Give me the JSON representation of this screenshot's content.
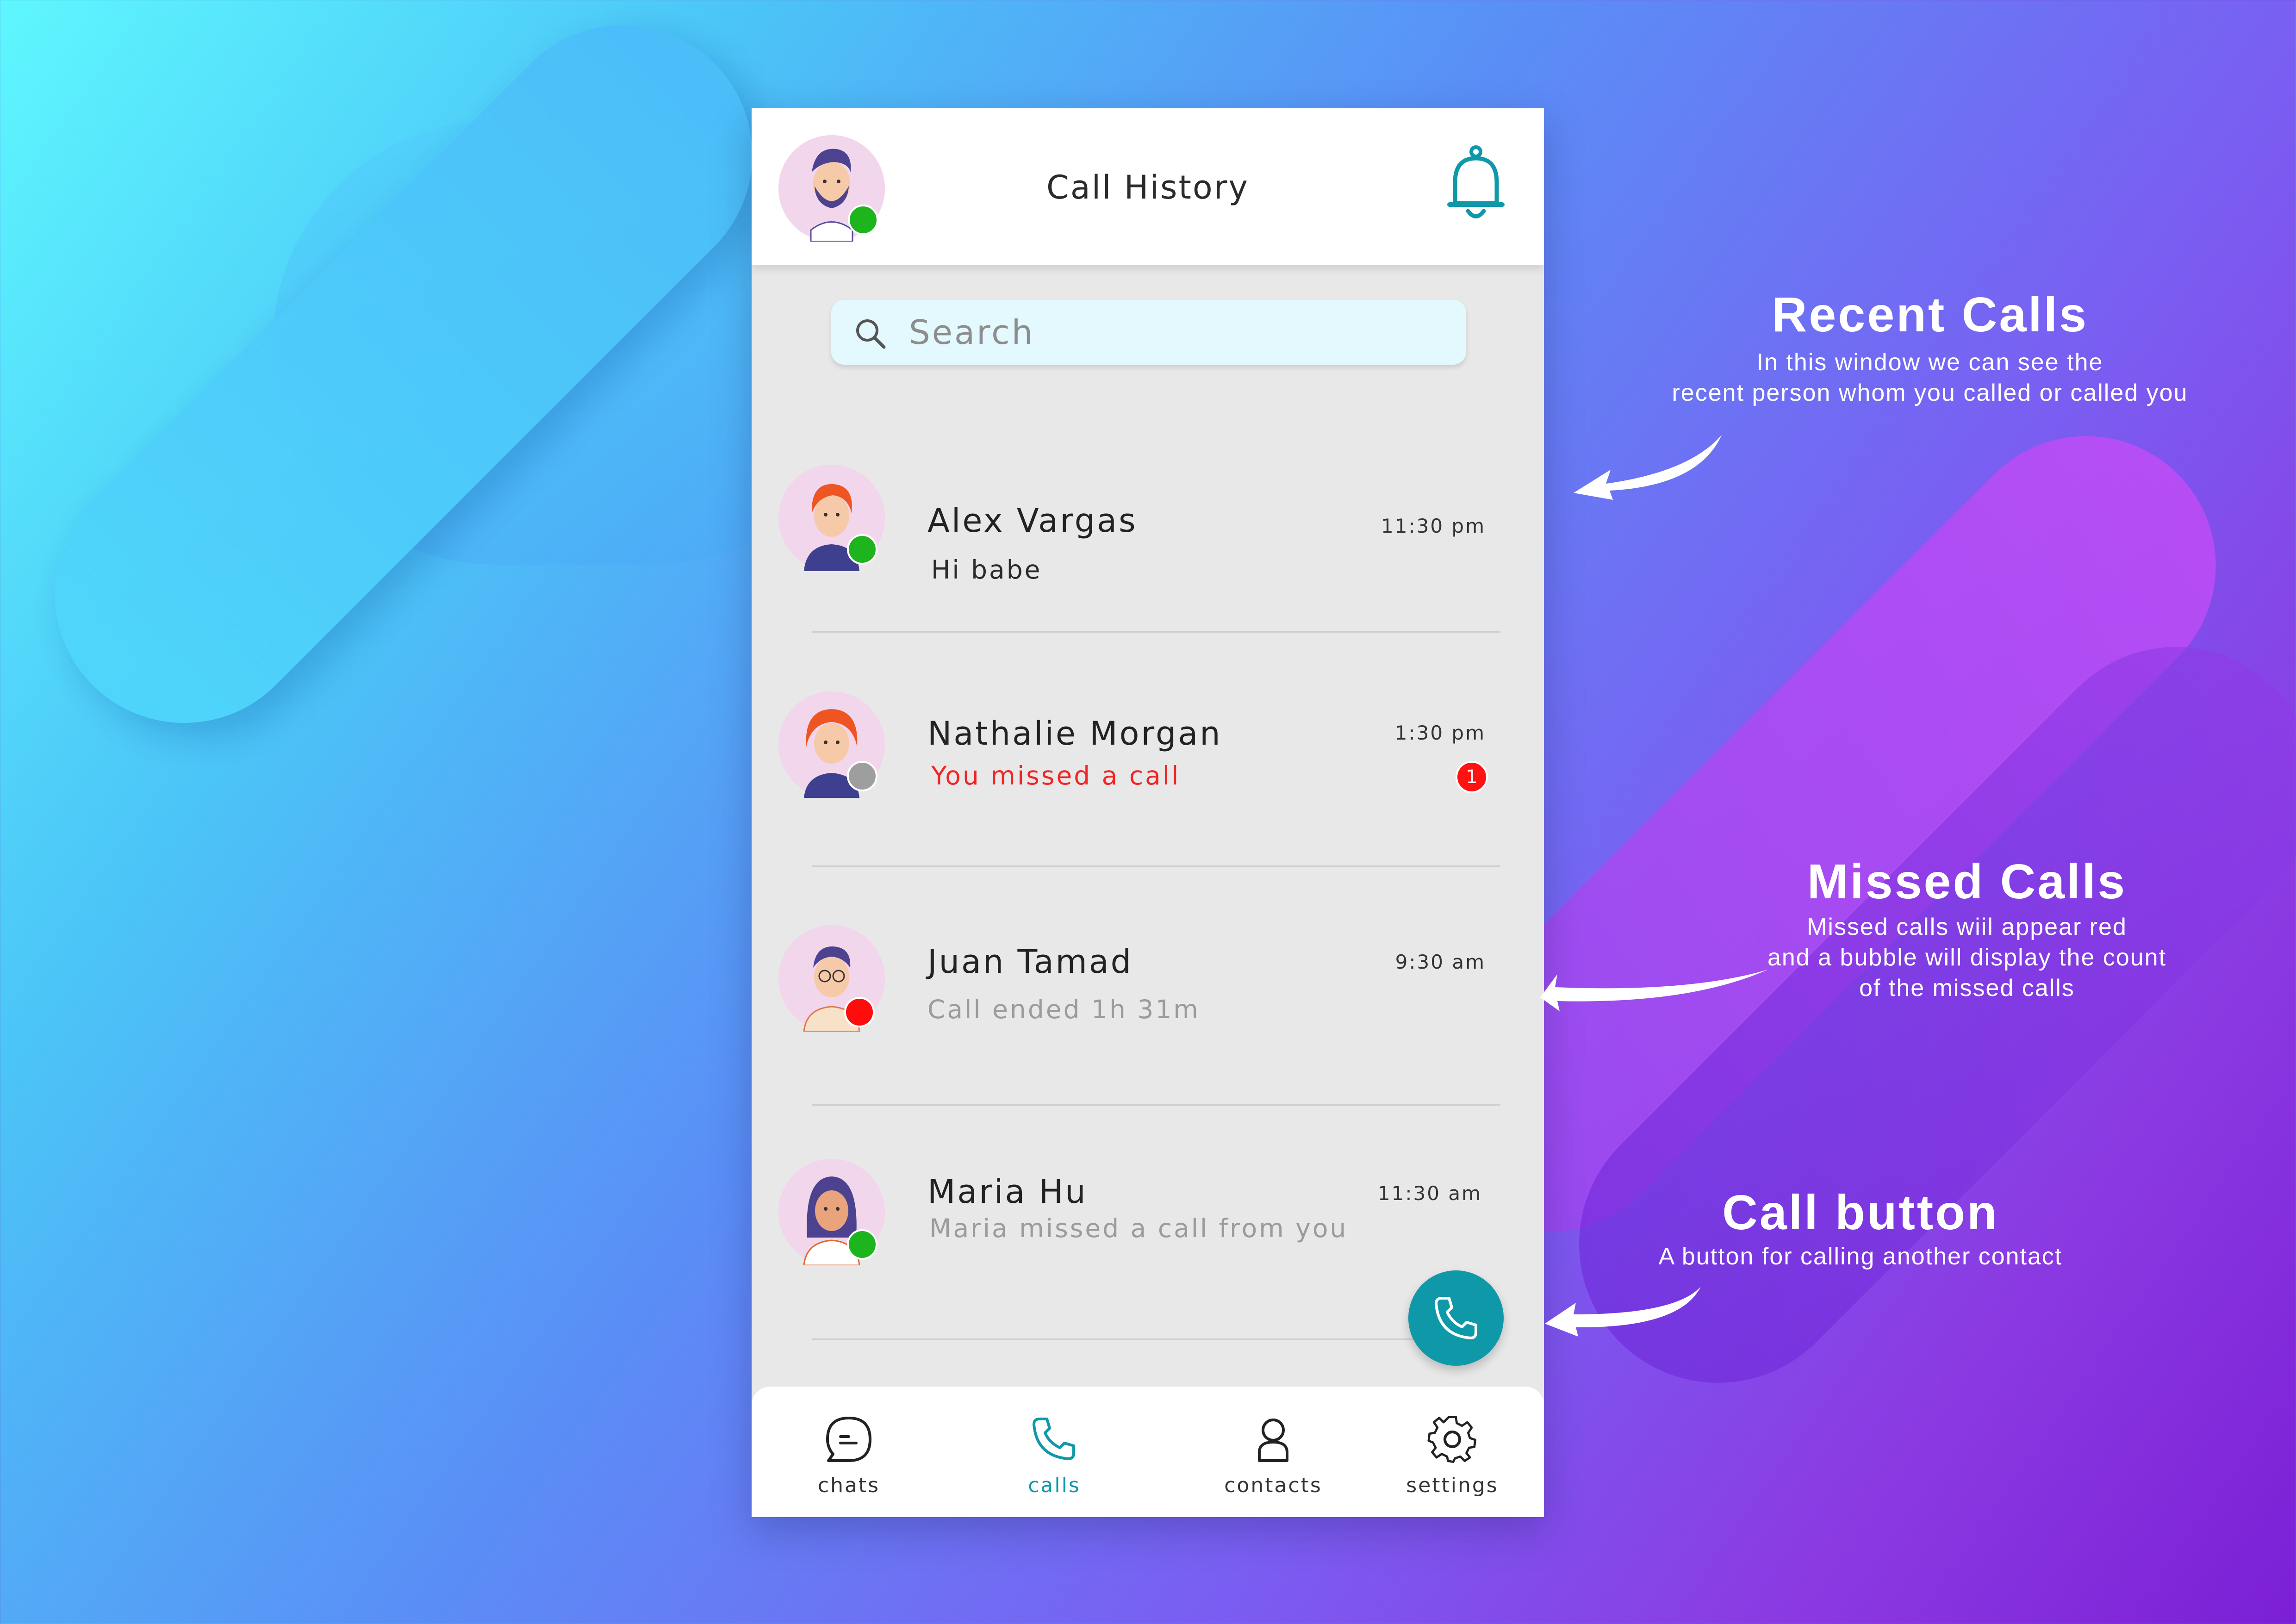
{
  "header": {
    "title": "Call History"
  },
  "search": {
    "placeholder": "Search"
  },
  "calls": [
    {
      "name": "Alex Vargas",
      "subtitle": "Hi babe",
      "time": "11:30 pm",
      "status": "online",
      "status_color": "#1db41d",
      "subtitle_style": "normal"
    },
    {
      "name": "Nathalie Morgan",
      "subtitle": "You missed a call",
      "time": "1:30 pm",
      "status": "offline",
      "status_color": "#9e9e9e",
      "subtitle_style": "missed",
      "missed_count": "1"
    },
    {
      "name": "Juan Tamad",
      "subtitle": "Call ended 1h 31m",
      "time": "9:30 am",
      "status": "busy",
      "status_color": "#ff0d0d",
      "subtitle_style": "muted"
    },
    {
      "name": "Maria Hu",
      "subtitle": "Maria missed a call from you",
      "time": "11:30 am",
      "status": "online",
      "status_color": "#1db41d",
      "subtitle_style": "muted"
    }
  ],
  "nav": [
    {
      "label": "chats",
      "icon": "chat-icon",
      "active": false
    },
    {
      "label": "calls",
      "icon": "phone-icon",
      "active": true
    },
    {
      "label": "contacts",
      "icon": "person-icon",
      "active": false
    },
    {
      "label": "settings",
      "icon": "gear-icon",
      "active": false
    }
  ],
  "annotations": {
    "recent": {
      "title": "Recent Calls",
      "line1": "In this window we can see the",
      "line2": "recent person whom you called or called you"
    },
    "missed": {
      "title": "Missed Calls",
      "line1": "Missed  calls wiil appear red",
      "line2": "and a bubble will display the count",
      "line3": "of the missed calls"
    },
    "callbutton": {
      "title": "Call button",
      "line1": "A button for calling another contact"
    }
  },
  "colors": {
    "accent": "#0f98a8",
    "missed": "#f02525",
    "online": "#1db41d",
    "busy": "#ff0d0d",
    "offline": "#9e9e9e"
  }
}
